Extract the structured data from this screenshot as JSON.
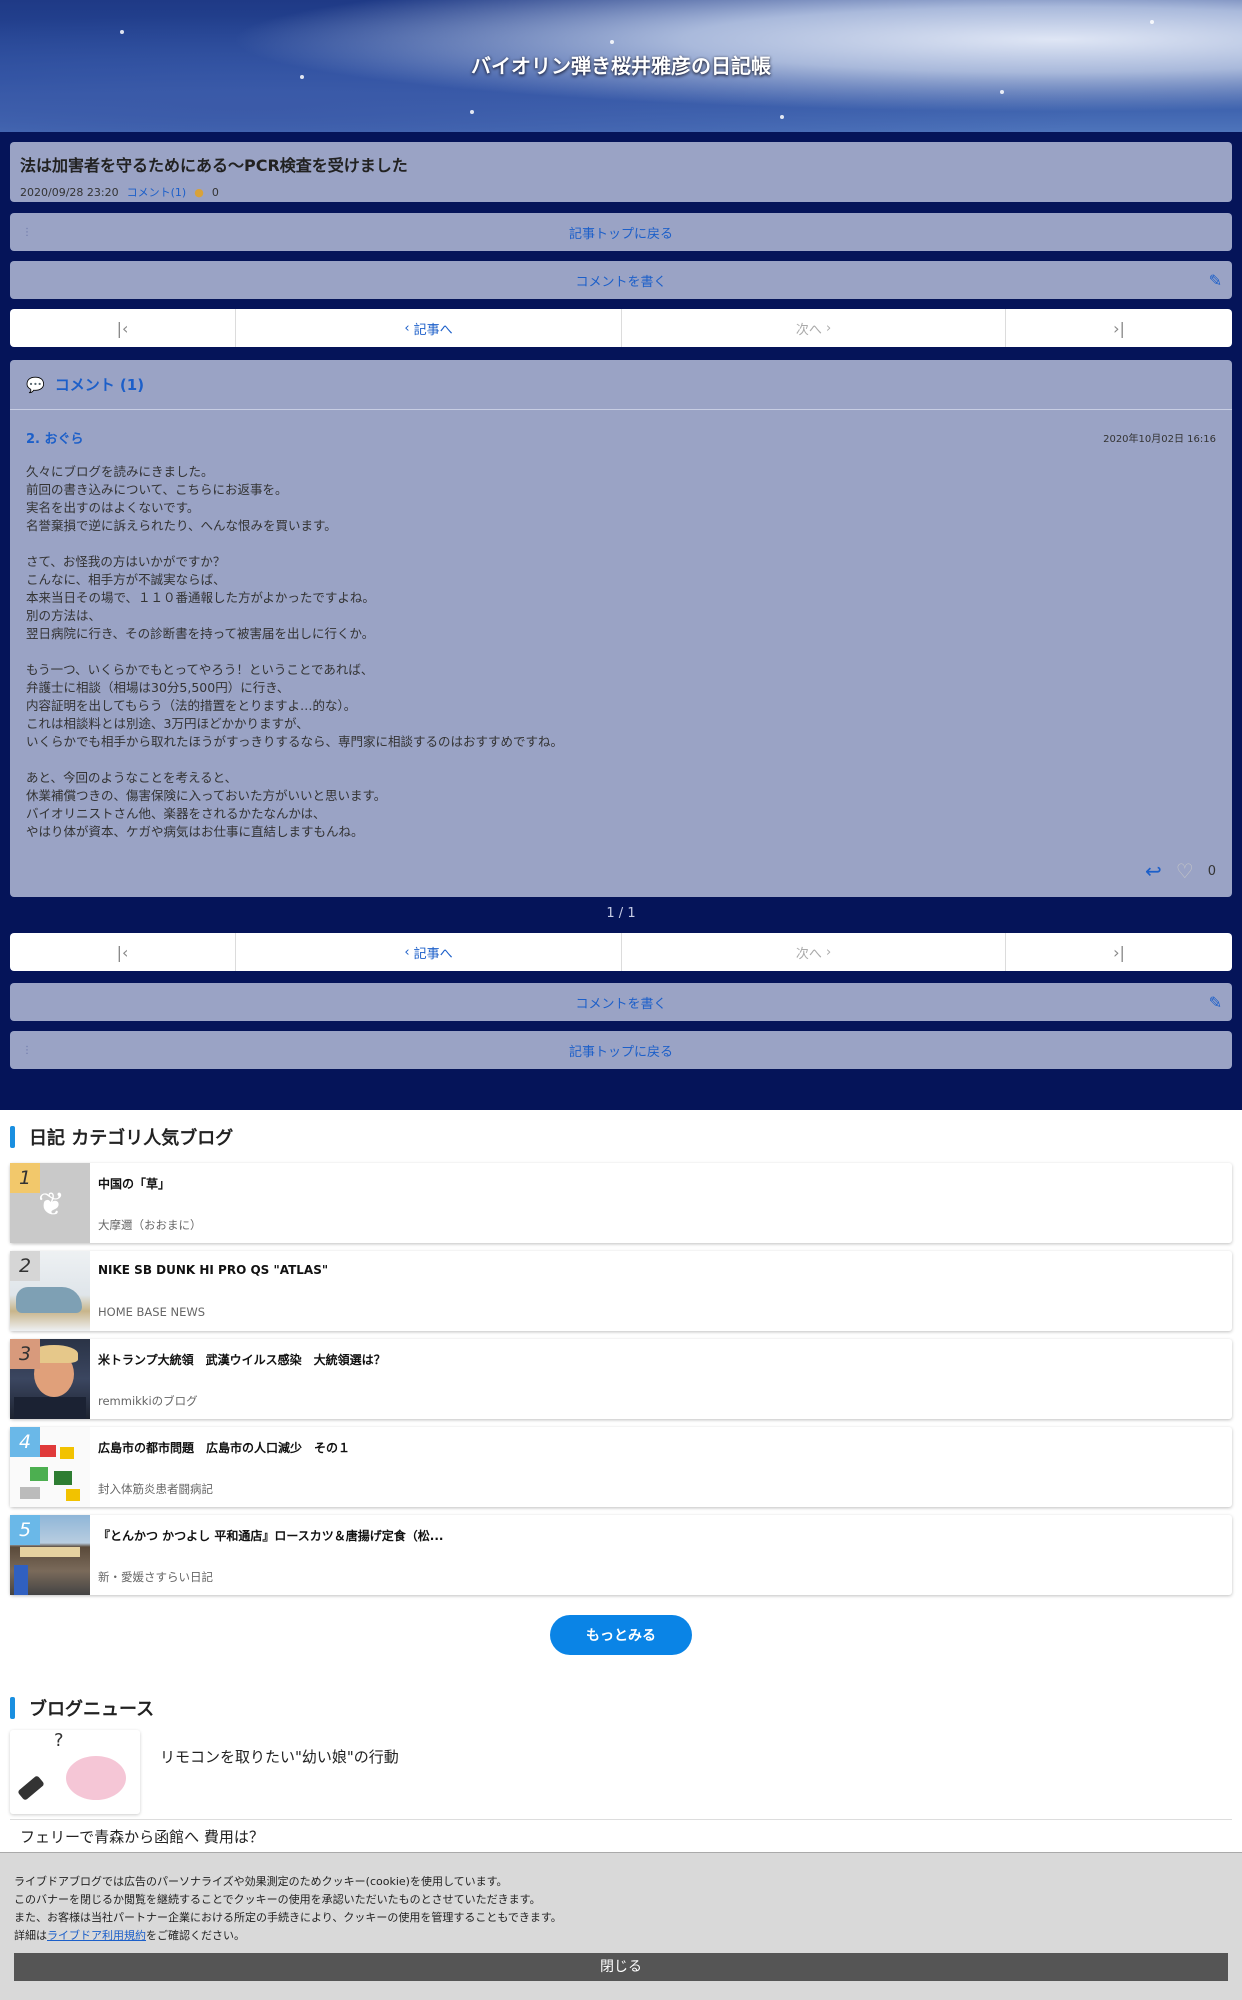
{
  "blog": {
    "title": "バイオリン弾き桜井雅彦の日記帳"
  },
  "article": {
    "title": "法は加害者を守るためにある〜PCR検査を受けました",
    "datetime": "2020/09/28 23:20",
    "comment_link": "コメント(1)",
    "like_count": "0"
  },
  "nav": {
    "back_to_top": "記事トップに戻る",
    "write_comment": "コメントを書く",
    "prev_label": "記事へ",
    "next_label": "次へ",
    "page_count": "1 / 1"
  },
  "comments": {
    "header": "コメント (1)",
    "items": [
      {
        "number_name": "2.  おぐら",
        "date": "2020年10月02日 16:16",
        "body": "久々にブログを読みにきました。\n前回の書き込みについて、こちらにお返事を。\n実名を出すのはよくないです。\n名誉棄損で逆に訴えられたり、へんな恨みを買います。\n\nさて、お怪我の方はいかがですか？\nこんなに、相手方が不誠実ならば、\n本来当日その場で、１１０番通報した方がよかったですよね。\n別の方法は、\n翌日病院に行き、その診断書を持って被害届を出しに行くか。\n\nもう一つ、いくらかでもとってやろう！ということであれば、\n弁護士に相談（相場は30分5,500円）に行き、\n内容証明を出してもらう（法的措置をとりますよ…的な）。\nこれは相談料とは別途、3万円ほどかかりますが、\nいくらかでも相手から取れたほうがすっきりするなら、専門家に相談するのはおすすめですね。\n\nあと、今回のようなことを考えると、\n休業補償つきの、傷害保険に入っておいた方がいいと思います。\nバイオリニストさん他、楽器をされるかたなんかは、\nやはり体が資本、ケガや病気はお仕事に直結しますもんね。",
        "like_count": "0"
      }
    ]
  },
  "ranking": {
    "section_title": "日記 カテゴリ人気ブログ",
    "items": [
      {
        "rank": "1",
        "title": "中国の「草」",
        "blog": "大摩邇（おおまに）"
      },
      {
        "rank": "2",
        "title": "NIKE SB DUNK HI PRO QS \"ATLAS\"",
        "blog": "HOME BASE NEWS"
      },
      {
        "rank": "3",
        "title": "米トランプ大統領　武漢ウイルス感染　大統領選は？",
        "blog": "remmikkiのブログ"
      },
      {
        "rank": "4",
        "title": "広島市の都市問題　広島市の人口減少　その１",
        "blog": "封入体筋炎患者闘病記"
      },
      {
        "rank": "5",
        "title": "『とんかつ かつよし 平和通店』ロースカツ＆唐揚げ定食（松...",
        "blog": "新・愛媛さすらい日記"
      }
    ],
    "more_label": "もっとみる"
  },
  "news": {
    "section_title": "ブログニュース",
    "items": [
      {
        "title": "リモコンを取りたい\"幼い娘\"の行動"
      },
      {
        "title": "フェリーで青森から函館へ 費用は？"
      }
    ]
  },
  "cookie": {
    "line1": "ライブドアブログでは広告のパーソナライズや効果測定のためクッキー(cookie)を使用しています。",
    "line2": "このバナーを閉じるか閲覧を継続することでクッキーの使用を承認いただいたものとさせていただきます。",
    "line3": "また、お客様は当社パートナー企業における所定の手続きにより、クッキーの使用を管理することもできます。",
    "line4_pre": "詳細は",
    "line4_link": "ライブドア利用規約",
    "line4_post": "をご確認ください。",
    "close_label": "閉じる"
  },
  "colors": {
    "page_bg": "#051459",
    "panel": "#9aa3c5",
    "accent": "#1c5fc9",
    "more_button": "#0a84e6"
  }
}
